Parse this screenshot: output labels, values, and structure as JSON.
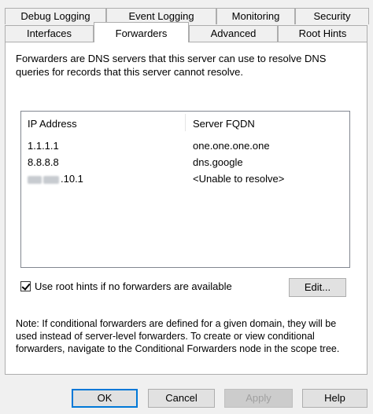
{
  "tabs": {
    "back_row": [
      "Debug Logging",
      "Event Logging",
      "Monitoring",
      "Security"
    ],
    "front_row": [
      "Interfaces",
      "Forwarders",
      "Advanced",
      "Root Hints"
    ],
    "selected": "Forwarders"
  },
  "page": {
    "description": "Forwarders are DNS servers that this server can use to resolve DNS queries for records that this server cannot resolve.",
    "list": {
      "columns": [
        "IP Address",
        "Server FQDN"
      ],
      "rows": [
        {
          "ip": "1.1.1.1",
          "fqdn": "one.one.one.one"
        },
        {
          "ip": "8.8.8.8",
          "fqdn": "dns.google"
        },
        {
          "ip_suffix": ".10.1",
          "fqdn": "<Unable to resolve>"
        }
      ]
    },
    "use_root_hints": {
      "label": "Use root hints if no forwarders are available",
      "checked": true
    },
    "edit_button": "Edit...",
    "note": "Note: If conditional forwarders are defined for a given domain, they will be used instead of server-level forwarders.  To create or view conditional forwarders, navigate to the Conditional Forwarders node in the scope tree."
  },
  "buttons": {
    "ok": "OK",
    "cancel": "Cancel",
    "apply": "Apply",
    "help": "Help"
  }
}
